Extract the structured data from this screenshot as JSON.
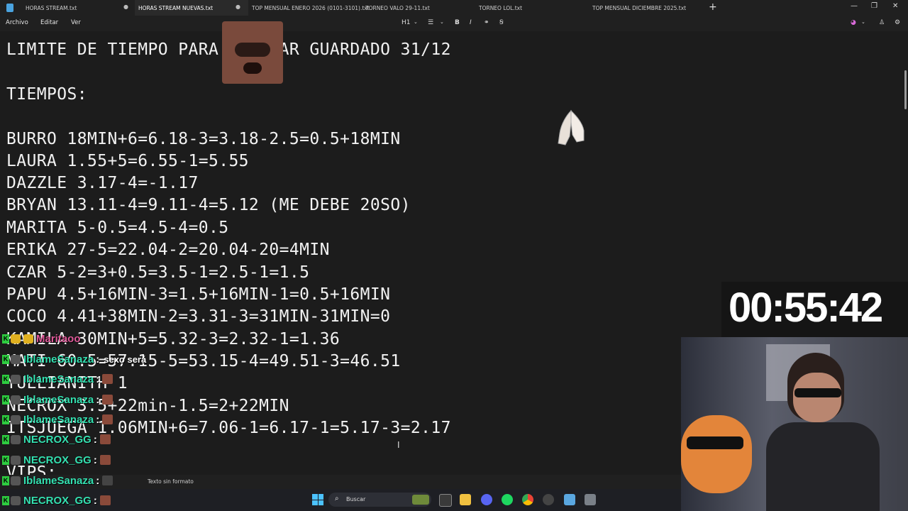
{
  "tabs": [
    {
      "label": "HORAS STREAM.txt",
      "dirty": true
    },
    {
      "label": "HORAS STREAM NUEVAS.txt",
      "active": true
    },
    {
      "label": "TOP MENSUAL ENERO 2026 (0101-3101).txt"
    },
    {
      "label": "TORNEO VALO 29-11.txt"
    },
    {
      "label": "TORNEO LOL.txt"
    },
    {
      "label": "TOP MENSUAL DICIEMBRE 2025.txt"
    }
  ],
  "menu": [
    "Archivo",
    "Editar",
    "Ver"
  ],
  "toolbar": {
    "heading": "H1",
    "bold": "B",
    "italic": "I"
  },
  "editor_lines": [
    "LIMITE DE TIEMPO PARA CANJEAR GUARDADO 31/12",
    "",
    "TIEMPOS:",
    "",
    "BURRO 18MIN+6=6.18-3=3.18-2.5=0.5+18MIN",
    "LAURA 1.55+5=6.55-1=5.55",
    "DAZZLE 3.17-4=-1.17",
    "BRYAN 13.11-4=9.11-4=5.12 (ME DEBE 20SO)",
    "MARITA 5-0.5=4.5-4=0.5",
    "ERIKA 27-5=22.04-2=20.04-20=4MIN",
    "CZAR 5-2=3+0.5=3.5-1=2.5-1=1.5",
    "PAPU 4.5+16MIN-3=1.5+16MIN-1=0.5+16MIN",
    "COCO 4.41+38MIN-2=3.31-3=31MIN-31MIN=0",
    "KAMILA 30MIN+5=5.32-3=2.32-1=1.36",
    "MATI 60.5=57.15-5=53.15-4=49.51-3=46.51",
    "YULLIANITH 1",
    "NECROX 3.5+22min-1.5=2+22MIN",
    "ITSJUEGA 1.06MIN+6=7.06-1=6.17-1=5.17-3=2.17",
    "",
    "VIPS:"
  ],
  "status": {
    "format": "Texto sin formato"
  },
  "taskbar": {
    "search_placeholder": "Buscar"
  },
  "timer": "00:55:42",
  "chat": [
    {
      "user": "Maritaoo",
      "color": "#e05a9a",
      "message": ""
    },
    {
      "user": "IblameSanaza",
      "color": "#34e0b0",
      "message": "sexo será"
    },
    {
      "user": "IblameSanaza",
      "color": "#34e0b0",
      "message": ""
    },
    {
      "user": "IblameSanaza",
      "color": "#34e0b0",
      "message": ""
    },
    {
      "user": "IblameSanaza",
      "color": "#34e0b0",
      "message": ""
    },
    {
      "user": "NECROX_GG",
      "color": "#34e0b0",
      "message": ""
    },
    {
      "user": "NECROX_GG",
      "color": "#34e0b0",
      "message": ""
    },
    {
      "user": "IblameSanaza",
      "color": "#34e0b0",
      "message": ""
    },
    {
      "user": "NECROX_GG",
      "color": "#34e0b0",
      "message": ""
    }
  ],
  "colors": {
    "editor_bg": "#1c1c1c",
    "chrome_bg": "#202020",
    "chat_name": "#34e0b0"
  }
}
